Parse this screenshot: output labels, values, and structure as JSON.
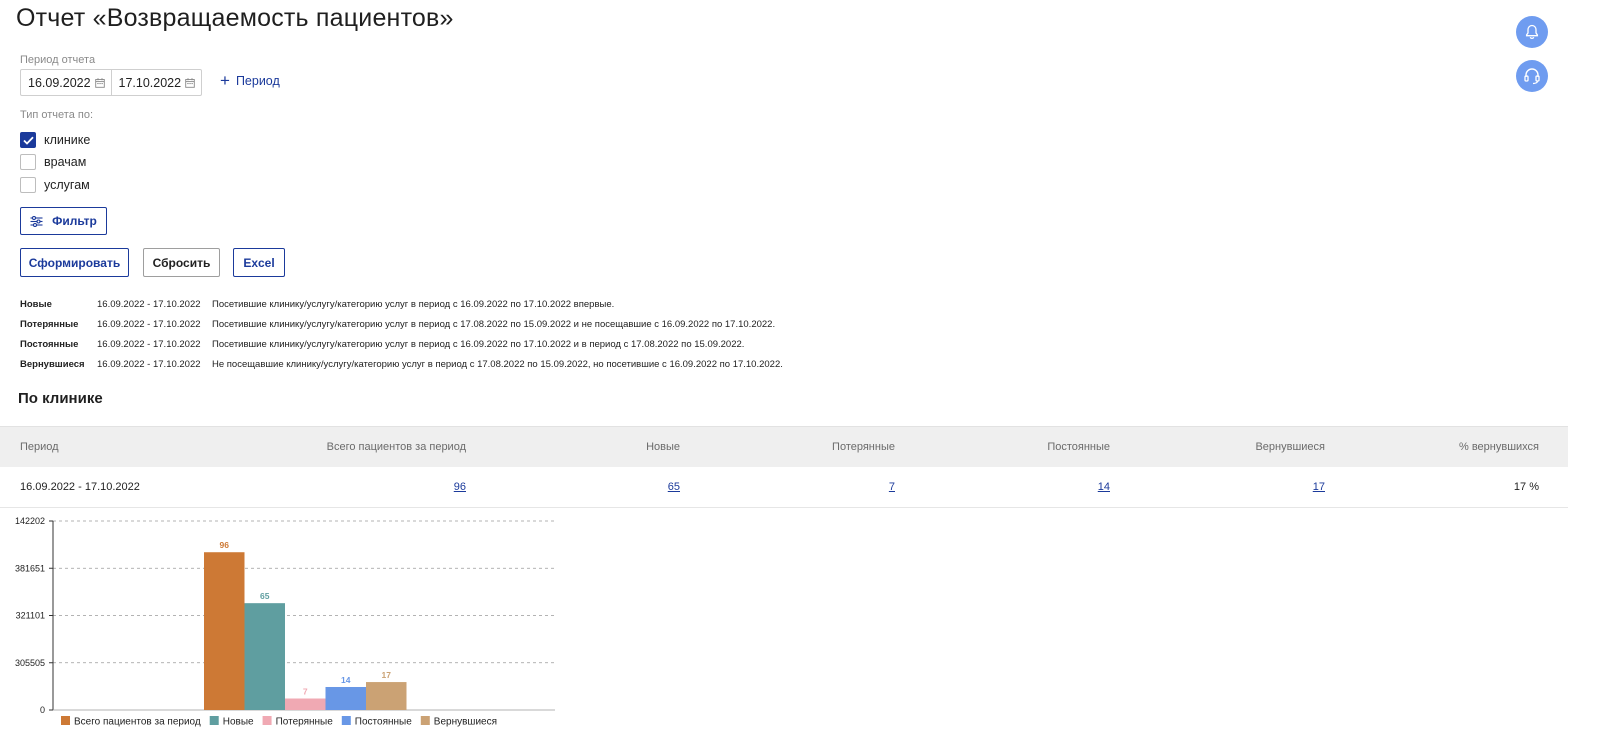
{
  "page": {
    "title": "Отчет «Возвращаемость пациентов»"
  },
  "icons": {
    "bell": "bell-icon",
    "support": "headset-icon",
    "calendar": "calendar-icon",
    "plus": "plus-icon",
    "filter": "sliders-icon",
    "check": "check-icon"
  },
  "colors": {
    "accent": "#1b3a9b",
    "round_button": "#6f9cf0",
    "header_bg": "#efefef"
  },
  "period": {
    "label": "Период отчета",
    "date_from": "16.09.2022",
    "date_to": "17.10.2022",
    "add_label": "Период"
  },
  "report_type": {
    "label": "Тип отчета по:",
    "options": [
      {
        "label": "клинике",
        "checked": true
      },
      {
        "label": "врачам",
        "checked": false
      },
      {
        "label": "услугам",
        "checked": false
      }
    ]
  },
  "buttons": {
    "filter": "Фильтр",
    "generate": "Сформировать",
    "reset": "Сбросить",
    "excel": "Excel"
  },
  "definitions": [
    {
      "name": "Новые",
      "period": "16.09.2022 - 17.10.2022",
      "text": "Посетившие клинику/услугу/категорию услуг в период с 16.09.2022 по 17.10.2022 впервые."
    },
    {
      "name": "Потерянные",
      "period": "16.09.2022 - 17.10.2022",
      "text": "Посетившие клинику/услугу/категорию услуг в период с 17.08.2022 по 15.09.2022 и не посещавшие с 16.09.2022 по 17.10.2022."
    },
    {
      "name": "Постоянные",
      "period": "16.09.2022 - 17.10.2022",
      "text": "Посетившие клинику/услугу/категорию услуг в период с 16.09.2022 по 17.10.2022 и в период с 17.08.2022 по 15.09.2022."
    },
    {
      "name": "Вернувшиеся",
      "period": "16.09.2022 - 17.10.2022",
      "text": "Не посещавшие клинику/услугу/категорию услуг в период с 17.08.2022 по 15.09.2022, но посетившие с 16.09.2022 по 17.10.2022."
    }
  ],
  "section": {
    "title": "По клинике"
  },
  "table": {
    "headers": [
      "Период",
      "Всего пациентов за период",
      "Новые",
      "Потерянные",
      "Постоянные",
      "Вернувшиеся",
      "% вернувшихся"
    ],
    "row": {
      "period": "16.09.2022 - 17.10.2022",
      "total": "96",
      "new": "65",
      "lost": "7",
      "regular": "14",
      "returned": "17",
      "percent": "17 %"
    }
  },
  "chart_data": {
    "type": "bar",
    "categories": [
      "16.09.2022 - 17.10.2022"
    ],
    "series": [
      {
        "name": "Всего пациентов за период",
        "values": [
          96
        ],
        "color": "#cd7935"
      },
      {
        "name": "Новые",
        "values": [
          65
        ],
        "color": "#5f9ea0"
      },
      {
        "name": "Потерянные",
        "values": [
          7
        ],
        "color": "#f0a9b3"
      },
      {
        "name": "Постоянные",
        "values": [
          14
        ],
        "color": "#6897e6"
      },
      {
        "name": "Вернувшиеся",
        "values": [
          17
        ],
        "color": "#cba274"
      }
    ],
    "yticks": [
      "142202",
      "381651",
      "321101",
      "305505",
      "0"
    ],
    "ylim": [
      0,
      115
    ],
    "grid": true,
    "legend_position": "bottom",
    "data_labels": true
  }
}
